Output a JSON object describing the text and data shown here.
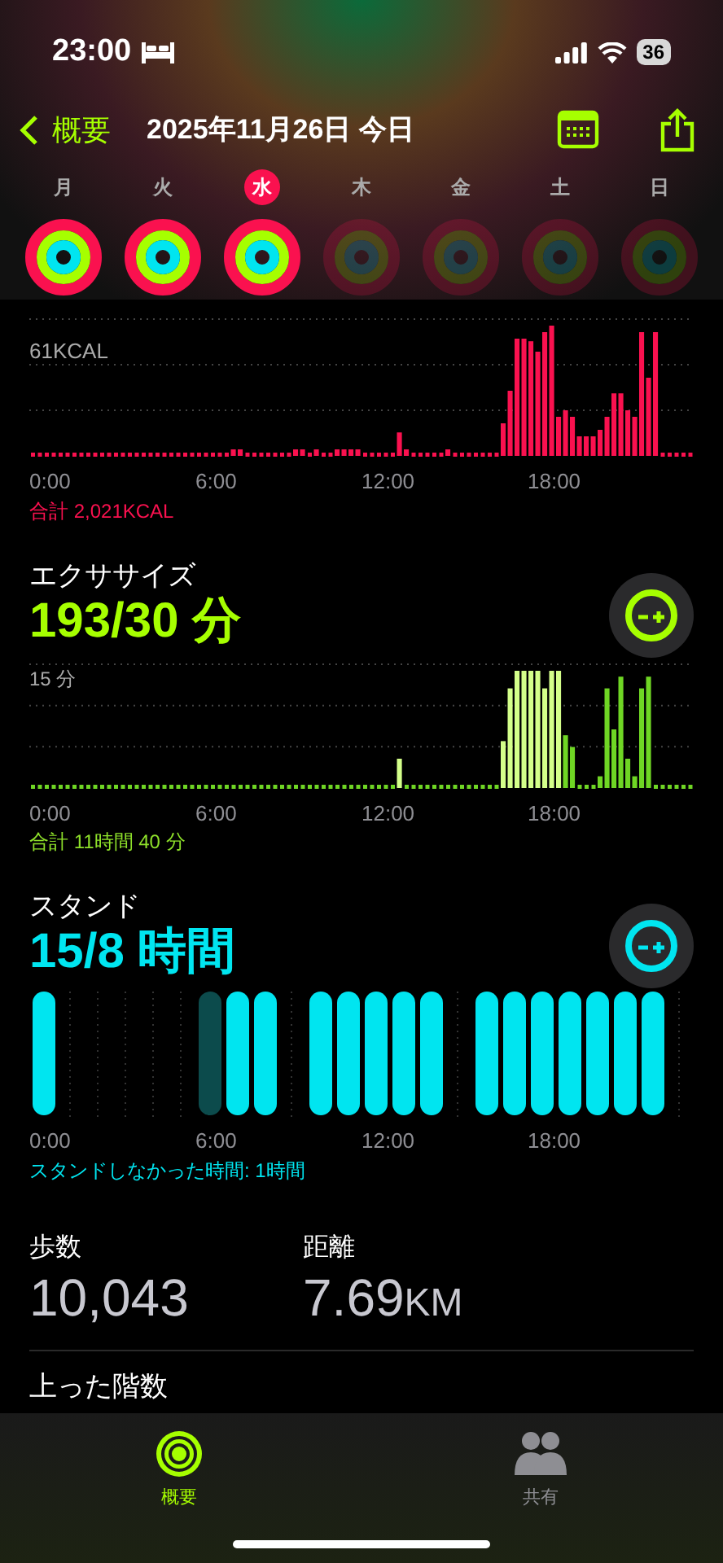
{
  "status_bar": {
    "time": "23:00",
    "battery": "36"
  },
  "nav": {
    "back": "概要",
    "title": "2025年11月26日 今日"
  },
  "week": [
    {
      "label": "月",
      "selected": false,
      "filled": true
    },
    {
      "label": "火",
      "selected": false,
      "filled": true
    },
    {
      "label": "水",
      "selected": true,
      "filled": true
    },
    {
      "label": "木",
      "selected": false,
      "filled": false
    },
    {
      "label": "金",
      "selected": false,
      "filled": false
    },
    {
      "label": "土",
      "selected": false,
      "filled": false
    },
    {
      "label": "日",
      "selected": false,
      "filled": false
    }
  ],
  "move": {
    "y_label": "61KCAL",
    "x_labels": [
      "0:00",
      "6:00",
      "12:00",
      "18:00"
    ],
    "total": "合計 2,021KCAL"
  },
  "exercise": {
    "title": "エクササイズ",
    "value": "193/30 分",
    "y_label": "15 分",
    "x_labels": [
      "0:00",
      "6:00",
      "12:00",
      "18:00"
    ],
    "total": "合計 11時間 40 分"
  },
  "stand": {
    "title": "スタンド",
    "value": "15/8 時間",
    "x_labels": [
      "0:00",
      "6:00",
      "12:00",
      "18:00"
    ],
    "note": "スタンドしなかった時間: 1時間"
  },
  "stats": [
    {
      "label": "歩数",
      "value": "10,043"
    },
    {
      "label": "距離",
      "value": "7.69",
      "unit": "KM"
    }
  ],
  "floors": {
    "label": "上った階数"
  },
  "tab_bar": [
    {
      "label": "概要",
      "selected": true
    },
    {
      "label": "共有",
      "selected": false
    }
  ]
}
